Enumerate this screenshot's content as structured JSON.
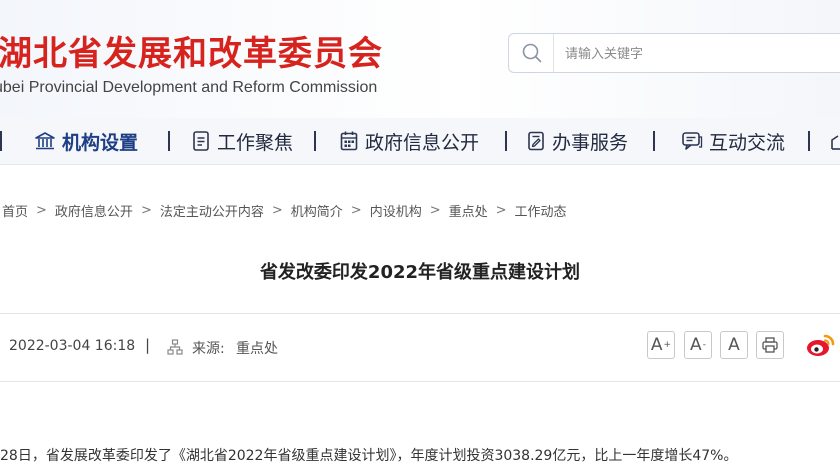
{
  "header": {
    "site_title": "湖北省发展和改革委员会",
    "site_subtitle": "ubei Provincial Development and Reform Commission",
    "search_placeholder": "请输入关键字"
  },
  "nav": {
    "items": [
      {
        "label": "机构设置",
        "icon": "building-icon",
        "active": true
      },
      {
        "label": "工作聚焦",
        "icon": "document-list-icon",
        "active": false
      },
      {
        "label": "政府信息公开",
        "icon": "calendar-grid-icon",
        "active": false
      },
      {
        "label": "办事服务",
        "icon": "clipboard-edit-icon",
        "active": false
      },
      {
        "label": "互动交流",
        "icon": "chat-bubble-icon",
        "active": false
      }
    ]
  },
  "breadcrumb": {
    "items": [
      "首页",
      "政府信息公开",
      "法定主动公开内容",
      "机构简介",
      "内设机构",
      "重点处",
      "工作动态"
    ],
    "separator": ">"
  },
  "article": {
    "title": "省发改委印发2022年省级重点建设计划",
    "date": "2022-03-04 16:18",
    "meta_separator": "|",
    "source_label": "来源:",
    "source_value": "重点处",
    "body_first_line": "28日，省发展改革委印发了《湖北省2022年省级重点建设计划》，年度计划投资3038.29亿元，比上一年度增长47%。"
  },
  "tools": {
    "font_increase": "A",
    "font_decrease": "A",
    "font_default": "A",
    "print_icon": "printer-icon",
    "share_icon": "weibo-icon"
  },
  "colors": {
    "brand_red": "#d7231d",
    "nav_active": "#1e3f85",
    "weibo_orange": "#f59a0f"
  }
}
